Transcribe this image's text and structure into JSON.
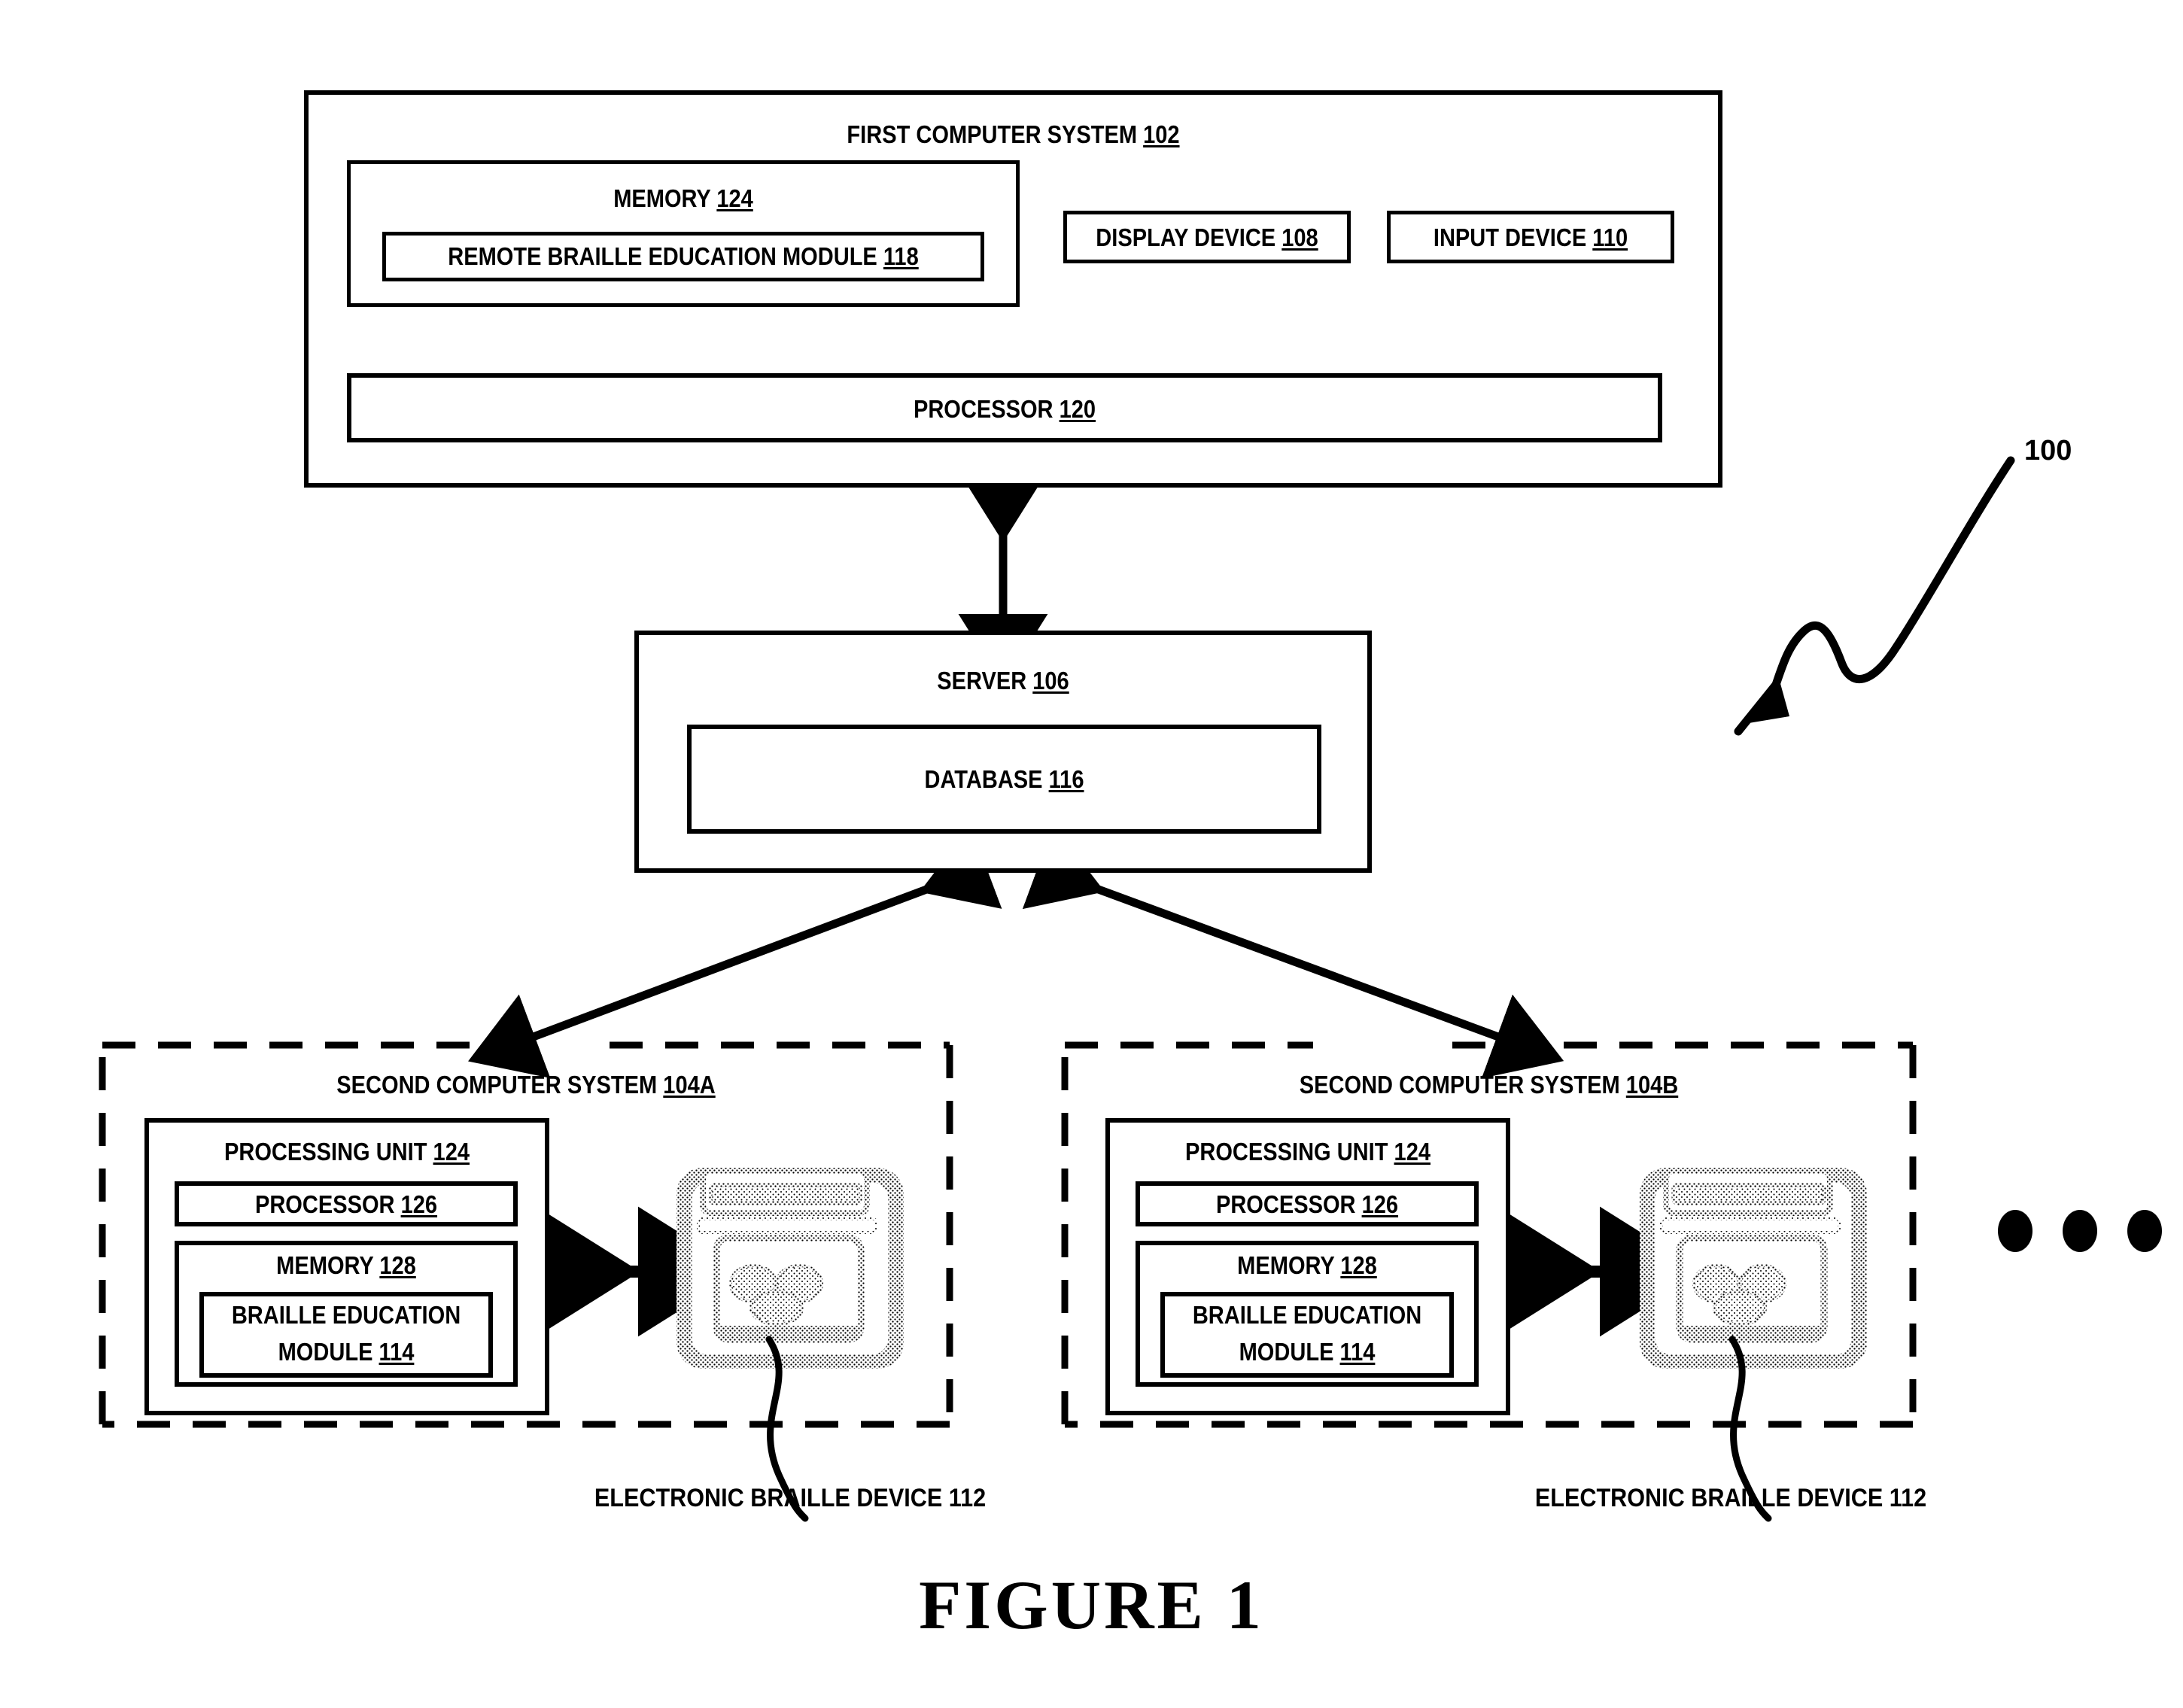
{
  "figure": {
    "caption": "FIGURE 1",
    "system_ref": "100"
  },
  "first_computer_system": {
    "title_text": "FIRST COMPUTER SYSTEM",
    "title_ref": "102",
    "memory": {
      "title_text": "MEMORY",
      "title_ref": "124",
      "module": {
        "text": "REMOTE BRAILLE EDUCATION MODULE",
        "ref": "118"
      }
    },
    "display_device": {
      "text": "DISPLAY DEVICE",
      "ref": "108"
    },
    "input_device": {
      "text": "INPUT DEVICE",
      "ref": "110"
    },
    "processor": {
      "text": "PROCESSOR",
      "ref": "120"
    }
  },
  "server": {
    "title_text": "SERVER",
    "title_ref": "106",
    "database": {
      "text": "DATABASE",
      "ref": "116"
    }
  },
  "second_computer_systems": [
    {
      "title_text": "SECOND COMPUTER SYSTEM",
      "title_ref": "104A",
      "processing_unit": {
        "text": "PROCESSING UNIT",
        "ref": "124"
      },
      "processor": {
        "text": "PROCESSOR",
        "ref": "126"
      },
      "memory": {
        "text": "MEMORY",
        "ref": "128"
      },
      "braille_module_line1": "BRAILLE EDUCATION",
      "braille_module_line2_text": "MODULE",
      "braille_module_ref": "114",
      "device_label": "ELECTRONIC BRAILLE DEVICE 112"
    },
    {
      "title_text": "SECOND COMPUTER SYSTEM",
      "title_ref": "104B",
      "processing_unit": {
        "text": "PROCESSING UNIT",
        "ref": "124"
      },
      "processor": {
        "text": "PROCESSOR",
        "ref": "126"
      },
      "memory": {
        "text": "MEMORY",
        "ref": "128"
      },
      "braille_module_line1": "BRAILLE EDUCATION",
      "braille_module_line2_text": "MODULE",
      "braille_module_ref": "114",
      "device_label": "ELECTRONIC BRAILLE DEVICE 112"
    }
  ],
  "ellipsis": {
    "dots": 3
  },
  "colors": {
    "ink": "#000000",
    "paper": "#ffffff"
  }
}
